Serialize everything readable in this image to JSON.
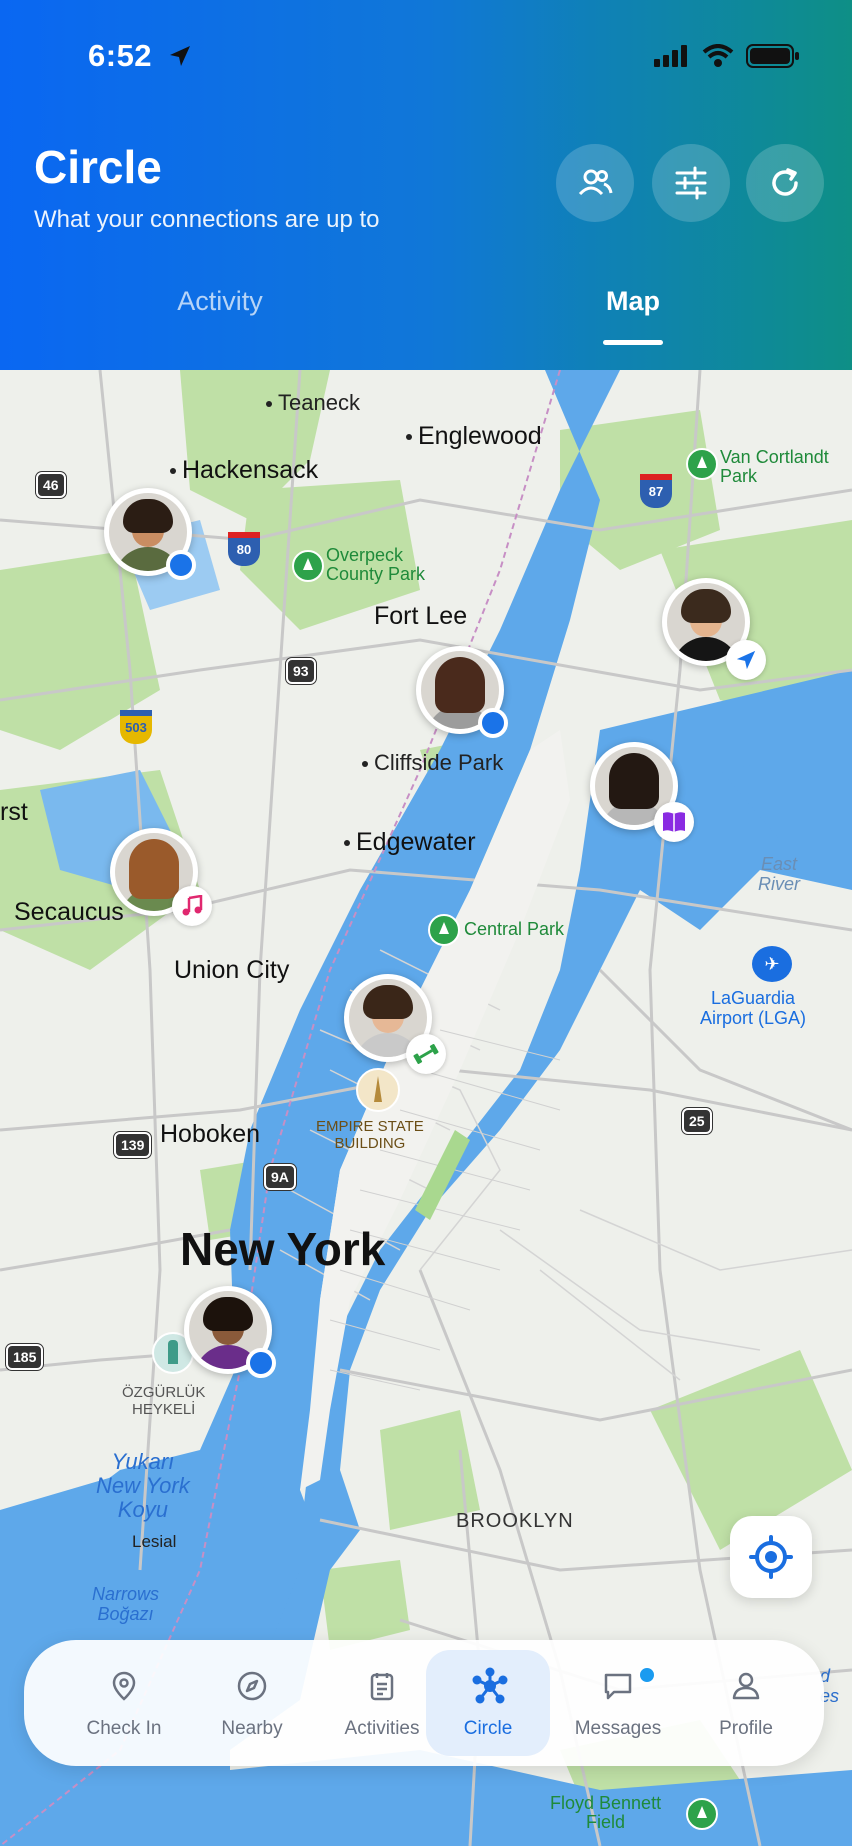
{
  "status": {
    "time": "6:52"
  },
  "header": {
    "title": "Circle",
    "subtitle": "What your connections are up to",
    "tabs": [
      {
        "label": "Activity"
      },
      {
        "label": "Map"
      }
    ],
    "active_tab": "Map"
  },
  "map": {
    "places": {
      "teaneck": "Teaneck",
      "englewood": "Englewood",
      "hackensack": "Hackensack",
      "fort_lee": "Fort Lee",
      "cliffside_park": "Cliffside Park",
      "edgewater": "Edgewater",
      "secaucus": "Secaucus",
      "union_city": "Union City",
      "hoboken": "Hoboken",
      "new_york": "New York",
      "brooklyn": "BROOKLYN",
      "lesial": "Lesial",
      "rst": "rst"
    },
    "parks": {
      "van_cortlandt": "Van Cortlandt\nPark",
      "overpeck": "Overpeck\nCounty Park",
      "central": "Central Park",
      "floyd_bennett": "Floyd Bennett\nField"
    },
    "water": {
      "east_river": "East\nRiver",
      "upper_bay": "Yukarı\nNew York\nKoyu",
      "narrows": "Narrows\nBoğazı"
    },
    "landmarks": {
      "empire_state": "EMPIRE STATE\nBUILDING",
      "statue_liberty": "ÖZGÜRLÜK\nHEYKELİ",
      "laguardia": "LaGuardia\nAirport (LGA)"
    },
    "shields": [
      "46",
      "80",
      "87",
      "93",
      "503",
      "139",
      "9A",
      "25",
      "185"
    ],
    "right_edge_text": "d\nes"
  },
  "navbar": {
    "items": [
      {
        "label": "Check In",
        "icon": "map-pin-icon"
      },
      {
        "label": "Nearby",
        "icon": "compass-icon"
      },
      {
        "label": "Activities",
        "icon": "clipboard-icon"
      },
      {
        "label": "Circle",
        "icon": "network-icon"
      },
      {
        "label": "Messages",
        "icon": "chat-icon"
      },
      {
        "label": "Profile",
        "icon": "user-icon"
      }
    ],
    "active": "Circle"
  },
  "colors": {
    "header_start": "#0a67f2",
    "header_end": "#0e8f86",
    "accent": "#1a6ee0",
    "water": "#5ea8ea",
    "park": "#2da24a"
  }
}
